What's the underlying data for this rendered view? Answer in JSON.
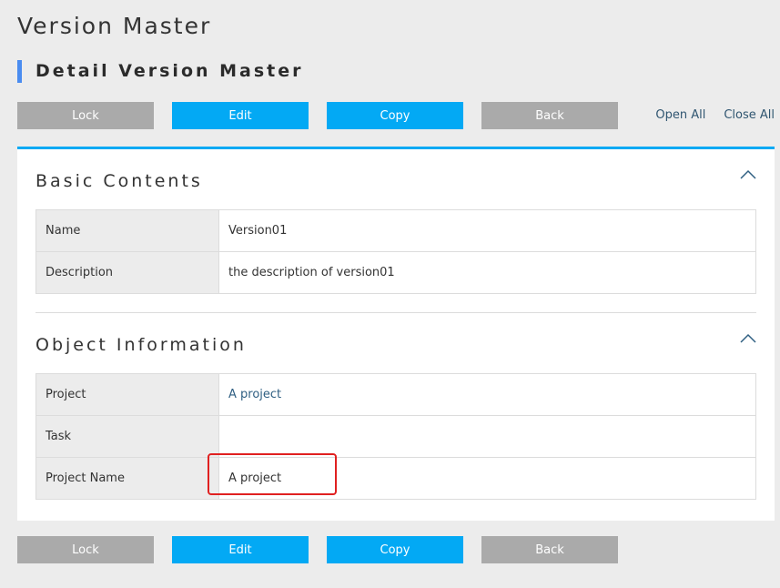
{
  "page": {
    "title": "Version Master",
    "subtitle": "Detail Version Master"
  },
  "actions": {
    "lock": "Lock",
    "edit": "Edit",
    "copy": "Copy",
    "back": "Back",
    "open_all": "Open All",
    "close_all": "Close All"
  },
  "colors": {
    "accent": "#03a9f4",
    "subtitle_bar": "#4a8cf0",
    "gray_button": "#aaaaaa",
    "highlight": "#e02020"
  },
  "sections": [
    {
      "title": "Basic Contents",
      "toggle_icon": "chevron-up-icon",
      "rows": [
        {
          "label": "Name",
          "value": "Version01",
          "link": false
        },
        {
          "label": "Description",
          "value": "the description of version01",
          "link": false
        }
      ]
    },
    {
      "title": "Object Information",
      "toggle_icon": "chevron-up-icon",
      "rows": [
        {
          "label": "Project",
          "value": "A project",
          "link": true
        },
        {
          "label": "Task",
          "value": "",
          "link": false
        },
        {
          "label": "Project Name",
          "value": "A project",
          "link": false
        }
      ]
    }
  ]
}
